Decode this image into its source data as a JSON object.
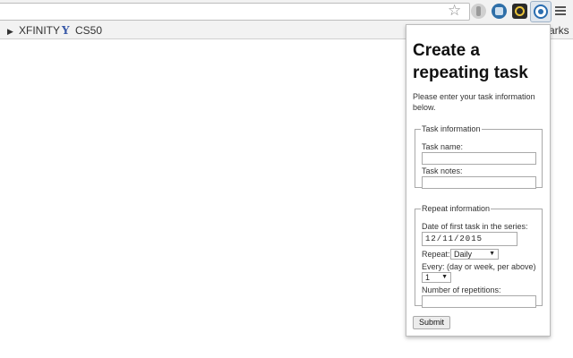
{
  "browser": {
    "bookmarks": [
      {
        "label": "XFINITY"
      },
      {
        "label": "CS50"
      }
    ],
    "bookmarks_overflow_label": "arks"
  },
  "popup": {
    "title": "Create a repeating task",
    "intro": "Please enter your task information below.",
    "task_info": {
      "legend": "Task information",
      "name_label": "Task name:",
      "name_value": "",
      "notes_label": "Task notes:",
      "notes_value": ""
    },
    "repeat_info": {
      "legend": "Repeat information",
      "date_label": "Date of first task in the series:",
      "date_value": "12/11/2015",
      "repeat_label": "Repeat:",
      "repeat_value": "Daily",
      "every_label": "Every: (day or week, per above)",
      "every_value": "1",
      "reps_label": "Number of repetitions:",
      "reps_value": ""
    },
    "submit_label": "Submit"
  },
  "icons": {
    "bookmark_star": "star-icon",
    "extension_active": "repeating-task-extension-icon",
    "menu": "hamburger-menu-icon"
  },
  "colors": {
    "accent": "#2a6db0"
  }
}
